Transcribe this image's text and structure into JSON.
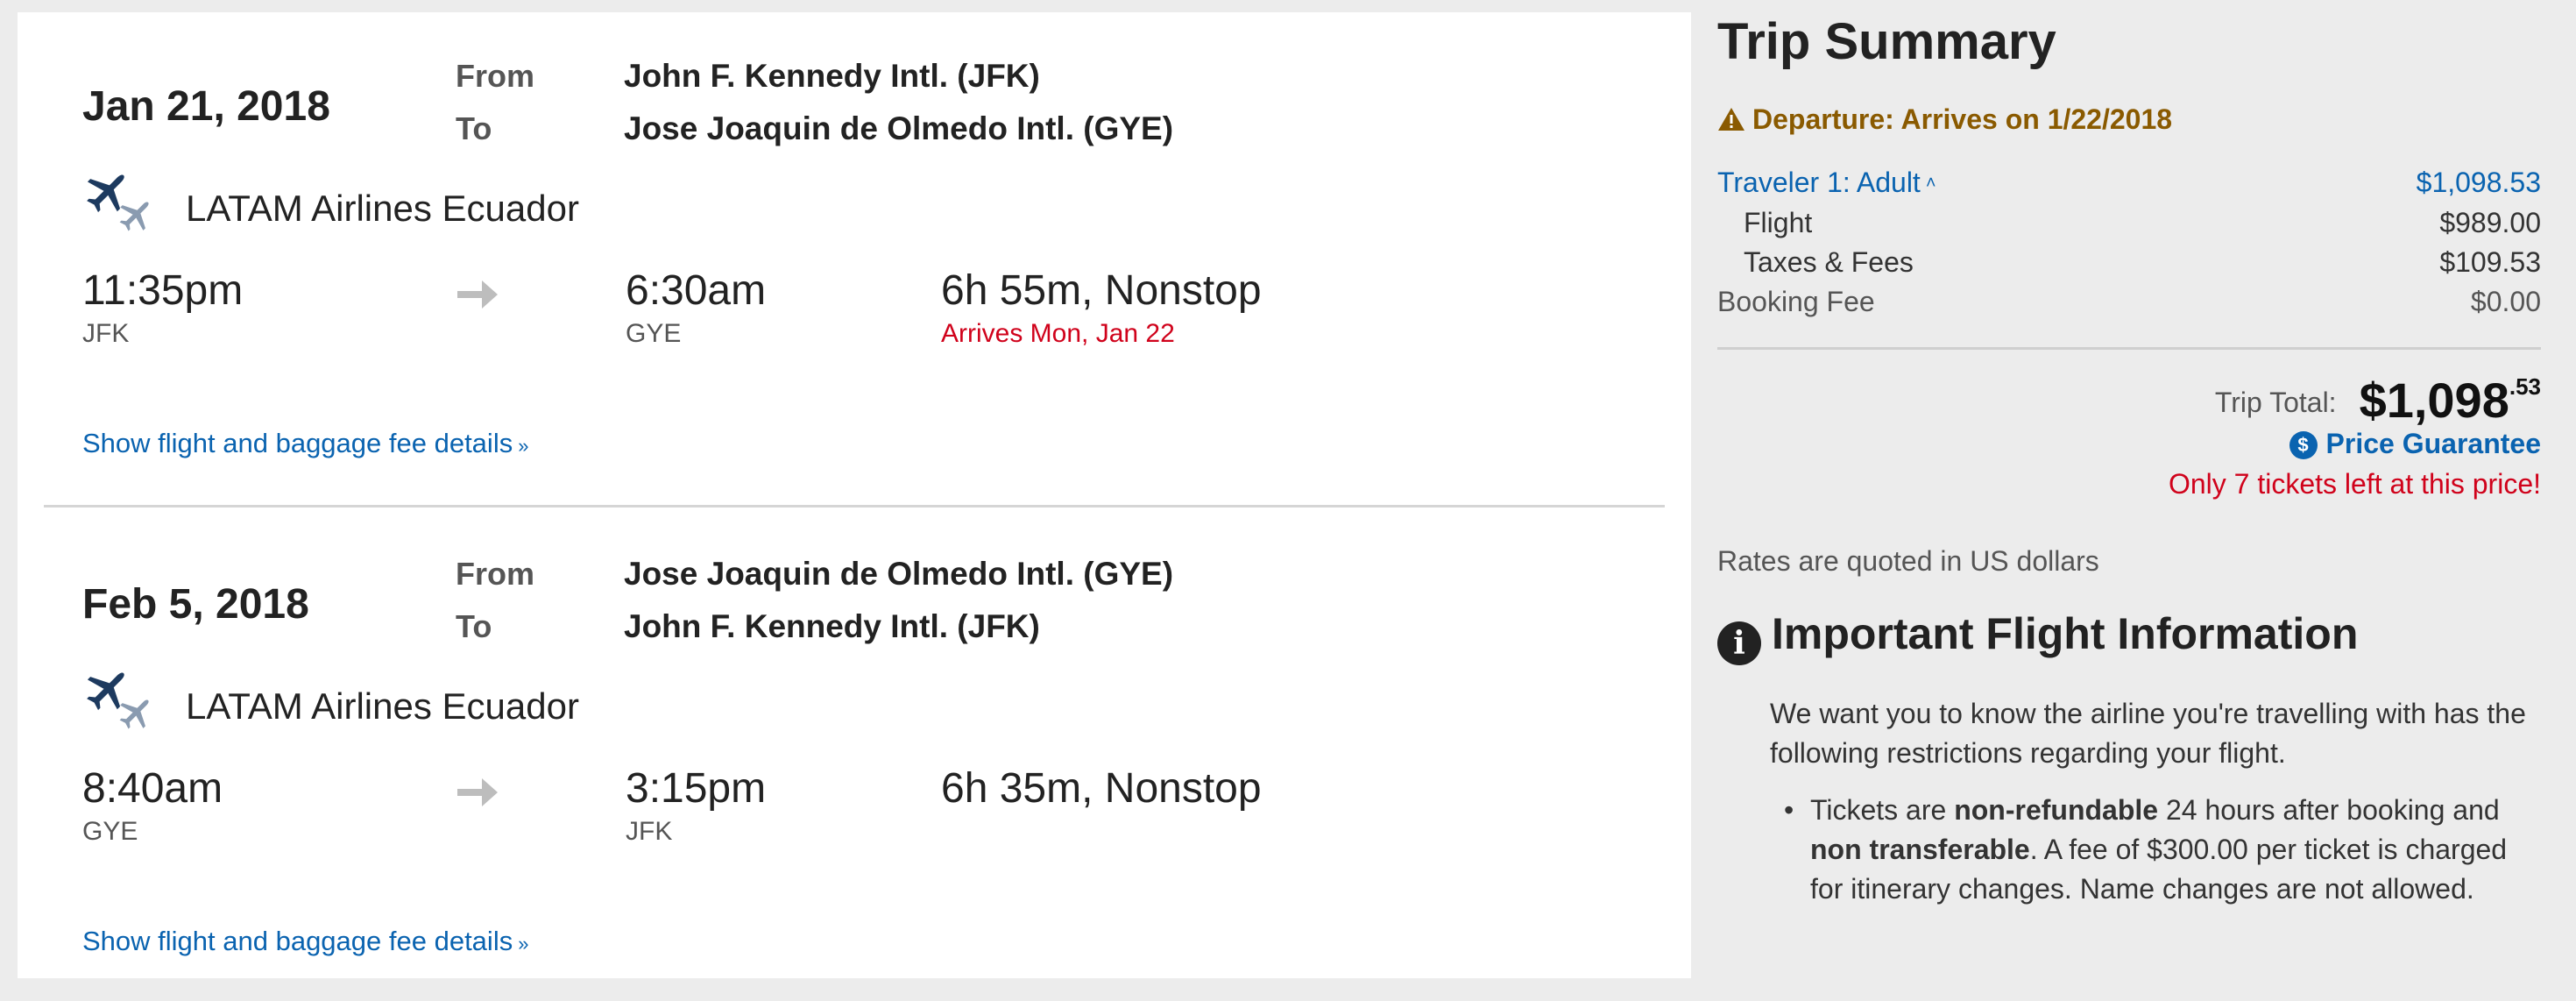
{
  "legs": [
    {
      "date": "Jan 21, 2018",
      "from_label": "From",
      "to_label": "To",
      "from_airport": "John F. Kennedy Intl. (JFK)",
      "to_airport": "Jose Joaquin de Olmedo Intl. (GYE)",
      "airline": "LATAM Airlines Ecuador",
      "depart_time": "11:35pm",
      "depart_code": "JFK",
      "arrive_time": "6:30am",
      "arrive_code": "GYE",
      "duration": "6h 55m, Nonstop",
      "arrival_note": "Arrives Mon, Jan 22",
      "details_link": "Show flight and baggage fee details"
    },
    {
      "date": "Feb 5, 2018",
      "from_label": "From",
      "to_label": "To",
      "from_airport": "Jose Joaquin de Olmedo Intl. (GYE)",
      "to_airport": "John F. Kennedy Intl. (JFK)",
      "airline": "LATAM Airlines Ecuador",
      "depart_time": "8:40am",
      "depart_code": "GYE",
      "arrive_time": "3:15pm",
      "arrive_code": "JFK",
      "duration": "6h 35m, Nonstop",
      "arrival_note": "",
      "details_link": "Show flight and baggage fee details"
    }
  ],
  "summary": {
    "title": "Trip Summary",
    "alert": "Departure: Arrives on 1/22/2018",
    "traveler_label": "Traveler 1: Adult",
    "traveler_amount": "$1,098.53",
    "flight_label": "Flight",
    "flight_amount": "$989.00",
    "taxes_label": "Taxes & Fees",
    "taxes_amount": "$109.53",
    "booking_label": "Booking Fee",
    "booking_amount": "$0.00",
    "total_label": "Trip Total:",
    "total_main": "$1,098",
    "total_cents": ".53",
    "guarantee": "Price Guarantee",
    "guarantee_icon_glyph": "$",
    "scarcity": "Only 7 tickets left at this price!",
    "rates_note": "Rates are quoted in US dollars"
  },
  "info": {
    "icon_glyph": "i",
    "heading": "Important Flight Information",
    "intro": "We want you to know the airline you're travelling with has the following restrictions regarding your flight.",
    "bullet_part1": "Tickets are ",
    "bullet_bold1": "non-refundable",
    "bullet_part2": " 24 hours after booking and ",
    "bullet_bold2": "non transferable",
    "bullet_part3": ". A fee of $300.00 per ticket is charged for itinerary changes. Name changes are not allowed."
  },
  "colors": {
    "link": "#0a63b0",
    "alert": "#d0021b",
    "warning": "#8a5a00",
    "plane_primary": "#1d3a5f",
    "plane_secondary": "#8a9bb0"
  },
  "icons": {
    "airline": "plane-icon",
    "arrow": "arrow-right-icon",
    "expand": "chevron-double-down-icon",
    "collapse": "chevron-double-up-icon",
    "warning": "warning-triangle-icon",
    "guarantee": "dollar-coin-icon",
    "info": "info-circle-icon"
  }
}
